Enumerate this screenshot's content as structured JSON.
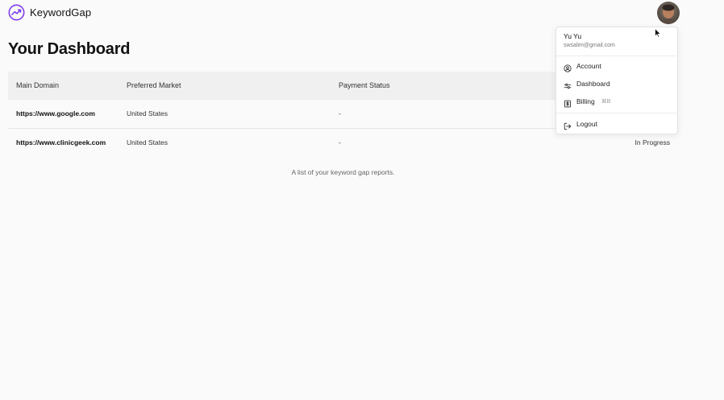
{
  "app": {
    "brand_name": "KeywordGap",
    "brand_color": "#7c3aed"
  },
  "page": {
    "title": "Your Dashboard"
  },
  "table": {
    "headers": [
      "Main Domain",
      "Preferred Market",
      "Payment Status"
    ],
    "rows": [
      {
        "domain": "https://www.google.com",
        "market": "United States",
        "payment": "-",
        "status": ""
      },
      {
        "domain": "https://www.clinicgeek.com",
        "market": "United States",
        "payment": "-",
        "status": "In Progress"
      }
    ],
    "caption": "A list of your keyword gap reports."
  },
  "user_menu": {
    "name": "Yu Yu",
    "email": "swsalim@gmail.com",
    "items": [
      {
        "label": "Account",
        "icon": "user-circle-icon"
      },
      {
        "label": "Dashboard",
        "icon": "sliders-icon"
      },
      {
        "label": "Billing",
        "icon": "dollar-icon",
        "shortcut": "⌘B"
      },
      {
        "label": "Logout",
        "icon": "logout-icon"
      }
    ]
  }
}
